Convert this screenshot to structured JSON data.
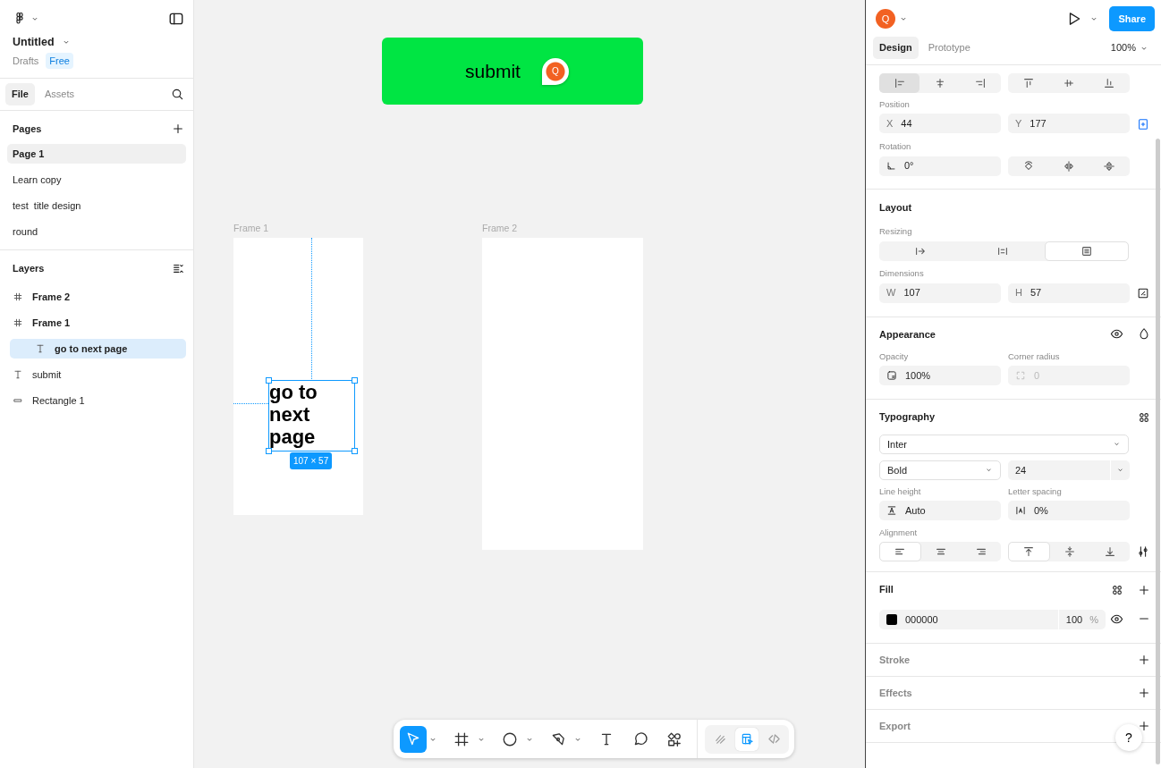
{
  "file": {
    "name": "Untitled",
    "location": "Drafts",
    "plan": "Free"
  },
  "left_tabs": [
    {
      "label": "File",
      "selected": true
    },
    {
      "label": "Assets",
      "selected": false
    }
  ],
  "pages": {
    "title": "Pages",
    "items": [
      {
        "label": "Page 1",
        "selected": true
      },
      {
        "label": "Learn copy",
        "selected": false
      },
      {
        "label": "test  title design",
        "selected": false
      },
      {
        "label": "round",
        "selected": false
      }
    ]
  },
  "layers": {
    "title": "Layers",
    "items": [
      {
        "label": "Frame 2",
        "kind": "frame",
        "selected": false
      },
      {
        "label": "Frame 1",
        "kind": "frame",
        "selected": false,
        "children": [
          {
            "label": "go to next page",
            "kind": "text",
            "selected": true
          }
        ]
      },
      {
        "label": "submit",
        "kind": "text",
        "selected": false
      },
      {
        "label": "Rectangle 1",
        "kind": "rectangle",
        "selected": false
      }
    ]
  },
  "canvas": {
    "button_shape": {
      "label": "submit",
      "cursor_initial": "Q"
    },
    "frames": [
      {
        "label": "Frame 1"
      },
      {
        "label": "Frame 2"
      }
    ],
    "selection": {
      "text": "go to next page",
      "size": "107 × 57"
    }
  },
  "toolbar": {
    "tools": [
      {
        "kind": "move",
        "selected": true,
        "menu": true
      },
      {
        "kind": "frame",
        "selected": false,
        "menu": true
      },
      {
        "kind": "shape",
        "selected": false,
        "menu": true
      },
      {
        "kind": "pen",
        "selected": false,
        "menu": true
      },
      {
        "kind": "text",
        "selected": false,
        "menu": false
      },
      {
        "kind": "comment",
        "selected": false,
        "menu": false
      },
      {
        "kind": "actions",
        "selected": false,
        "menu": false
      }
    ],
    "modes": [
      {
        "kind": "draw",
        "selected": false
      },
      {
        "kind": "design",
        "selected": true
      },
      {
        "kind": "code",
        "selected": false
      }
    ]
  },
  "header": {
    "avatar": "Q",
    "share": "Share",
    "tabs": [
      {
        "label": "Design",
        "selected": true
      },
      {
        "label": "Prototype",
        "selected": false
      }
    ],
    "zoom": "100%"
  },
  "align": [
    {
      "kind": "left",
      "selected": true
    },
    {
      "kind": "hcenter",
      "selected": false
    },
    {
      "kind": "right",
      "selected": false
    },
    {
      "kind": "top",
      "selected": false
    },
    {
      "kind": "vcenter",
      "selected": false
    },
    {
      "kind": "bottom",
      "selected": false
    }
  ],
  "position": {
    "label": "Position",
    "x": {
      "prefix": "X",
      "value": "44"
    },
    "y": {
      "prefix": "Y",
      "value": "177"
    }
  },
  "rotation": {
    "label": "Rotation",
    "value": "0°"
  },
  "layout": {
    "title": "Layout",
    "resizing_label": "Resizing",
    "resizing": [
      {
        "kind": "fixed",
        "selected": false
      },
      {
        "kind": "hug",
        "selected": false
      },
      {
        "kind": "fill",
        "selected": true
      }
    ],
    "dimensions_label": "Dimensions",
    "w": {
      "prefix": "W",
      "value": "107"
    },
    "h": {
      "prefix": "H",
      "value": "57"
    }
  },
  "appearance": {
    "title": "Appearance",
    "opacity_label": "Opacity",
    "opacity": "100%",
    "radius_label": "Corner radius",
    "radius": "0",
    "radius_disabled": true
  },
  "typography": {
    "title": "Typography",
    "font": "Inter",
    "weight": "Bold",
    "size": "24",
    "line_height_label": "Line height",
    "line_height": "Auto",
    "letter_spacing_label": "Letter spacing",
    "letter_spacing": "0%",
    "alignment_label": "Alignment",
    "h_align": [
      {
        "kind": "left",
        "selected": true
      },
      {
        "kind": "center",
        "selected": false
      },
      {
        "kind": "right",
        "selected": false
      }
    ],
    "v_align": [
      {
        "kind": "top",
        "selected": true
      },
      {
        "kind": "middle",
        "selected": false
      },
      {
        "kind": "bottom",
        "selected": false
      }
    ]
  },
  "fill": {
    "title": "Fill",
    "hex": "000000",
    "opacity": "100",
    "unit": "%"
  },
  "collapsed_sections": [
    {
      "title": "Stroke"
    },
    {
      "title": "Effects"
    },
    {
      "title": "Export"
    }
  ],
  "help": "?"
}
